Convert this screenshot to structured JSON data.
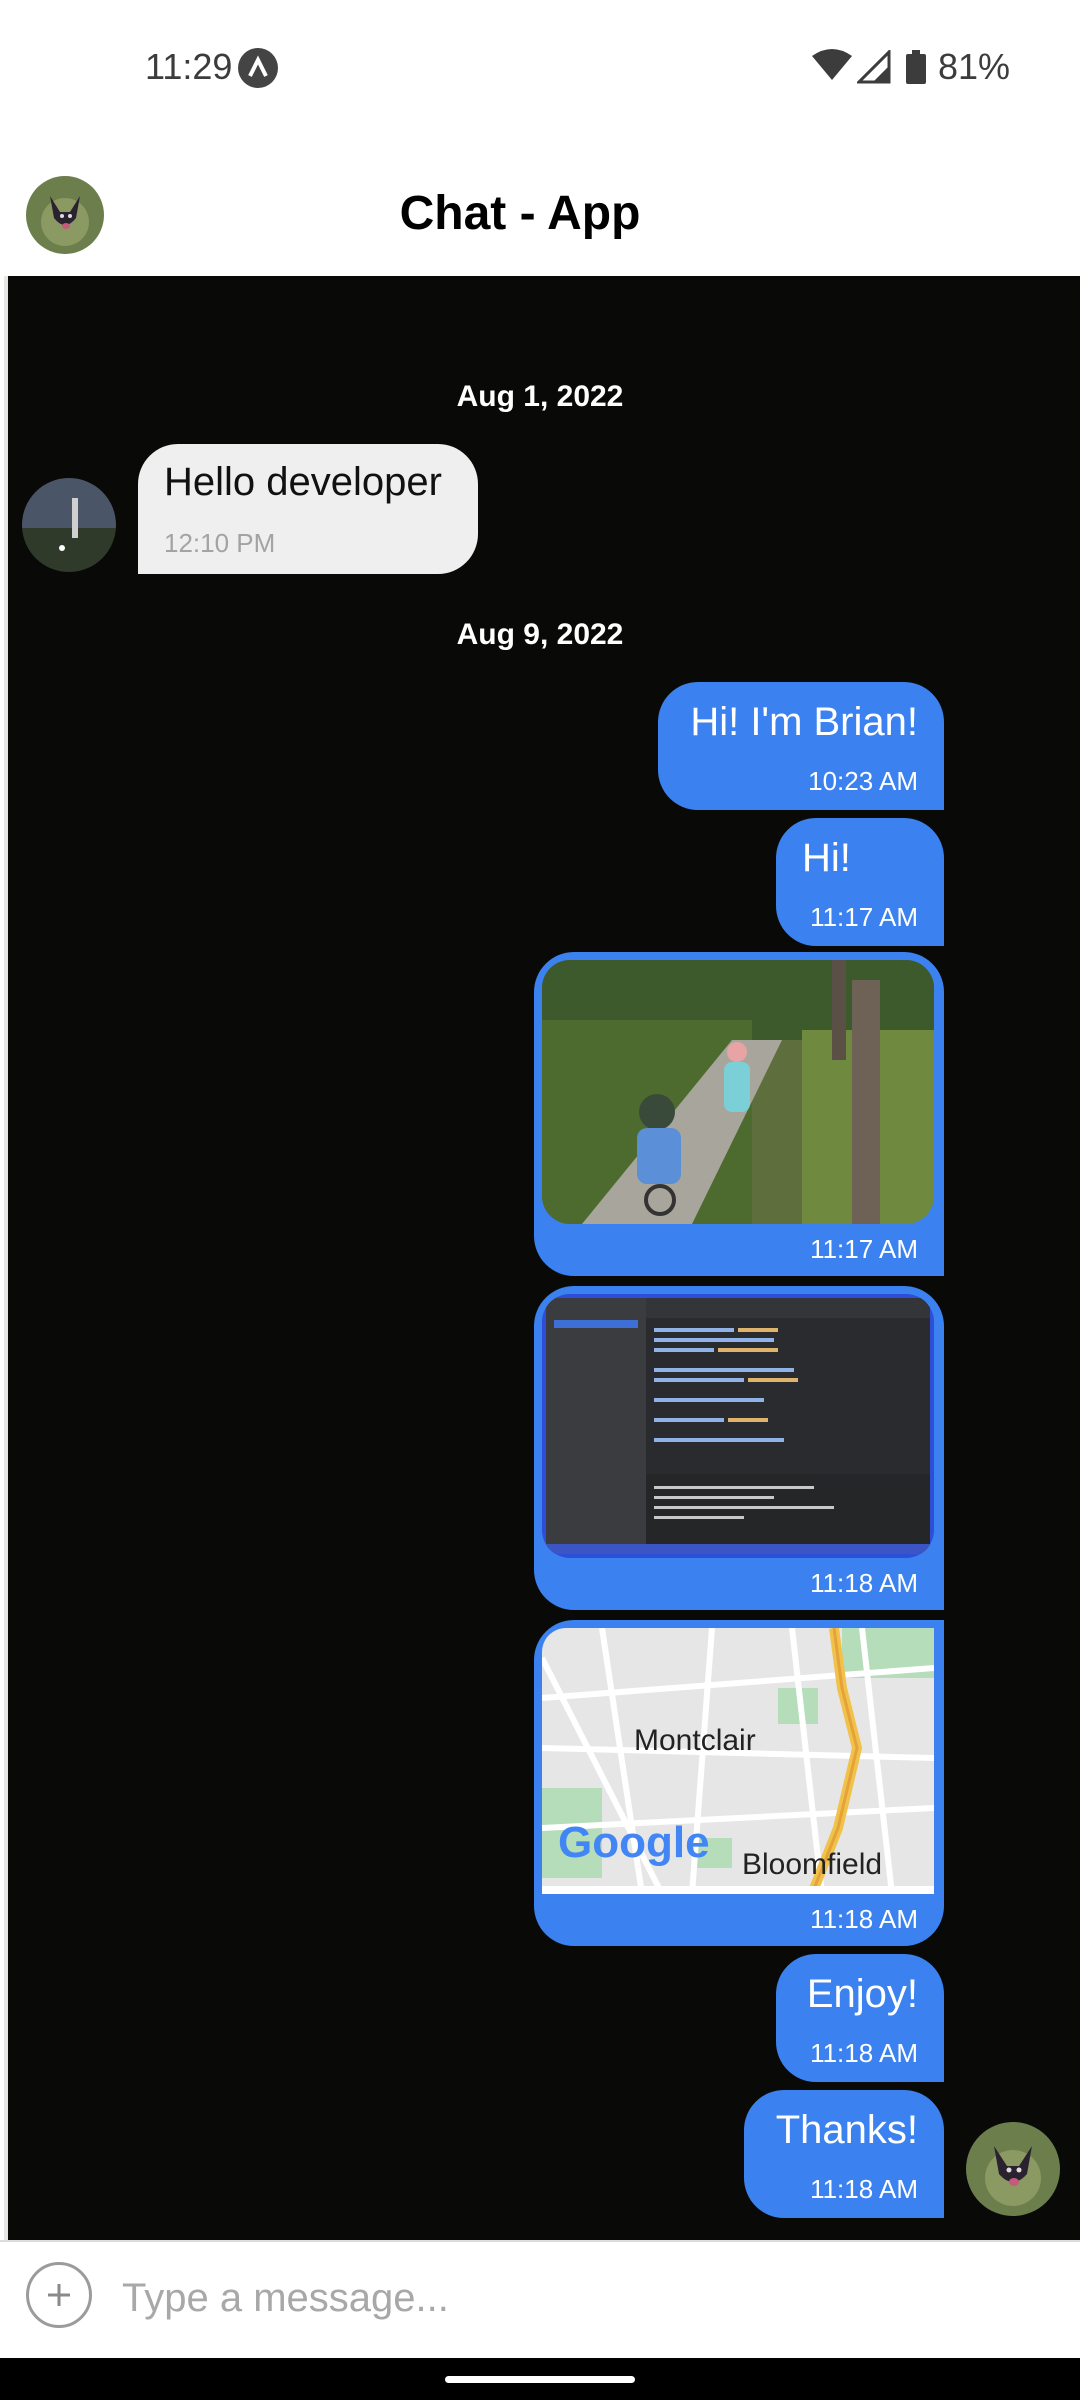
{
  "status": {
    "time": "11:29",
    "battery": "81%"
  },
  "header": {
    "title": "Chat - App"
  },
  "dates": [
    "Aug 1, 2022",
    "Aug 9, 2022"
  ],
  "messages": [
    {
      "direction": "incoming",
      "text": "Hello developer",
      "time": "12:10 PM"
    },
    {
      "direction": "outgoing",
      "text": "Hi! I'm Brian!",
      "time": "10:23 AM"
    },
    {
      "direction": "outgoing",
      "text": "Hi!",
      "time": "11:17 AM"
    },
    {
      "direction": "outgoing",
      "type": "image",
      "image": "photo-kids-biking",
      "time": "11:17 AM"
    },
    {
      "direction": "outgoing",
      "type": "image",
      "image": "photo-code-screen",
      "time": "11:18 AM"
    },
    {
      "direction": "outgoing",
      "type": "location",
      "map_labels": [
        "Montclair",
        "Bloomfield"
      ],
      "map_brand": "Google",
      "time": "11:18 AM"
    },
    {
      "direction": "outgoing",
      "text": "Enjoy!",
      "time": "11:18 AM"
    },
    {
      "direction": "outgoing",
      "text": "Thanks!",
      "time": "11:18 AM"
    }
  ],
  "input": {
    "placeholder": "Type a message..."
  },
  "colors": {
    "bubble_out": "#3b82f0",
    "bubble_in": "#efefef",
    "chat_bg": "#090a08"
  },
  "icons": [
    "app-status-icon",
    "wifi-icon",
    "signal-icon",
    "battery-icon",
    "add-attachment-icon"
  ]
}
